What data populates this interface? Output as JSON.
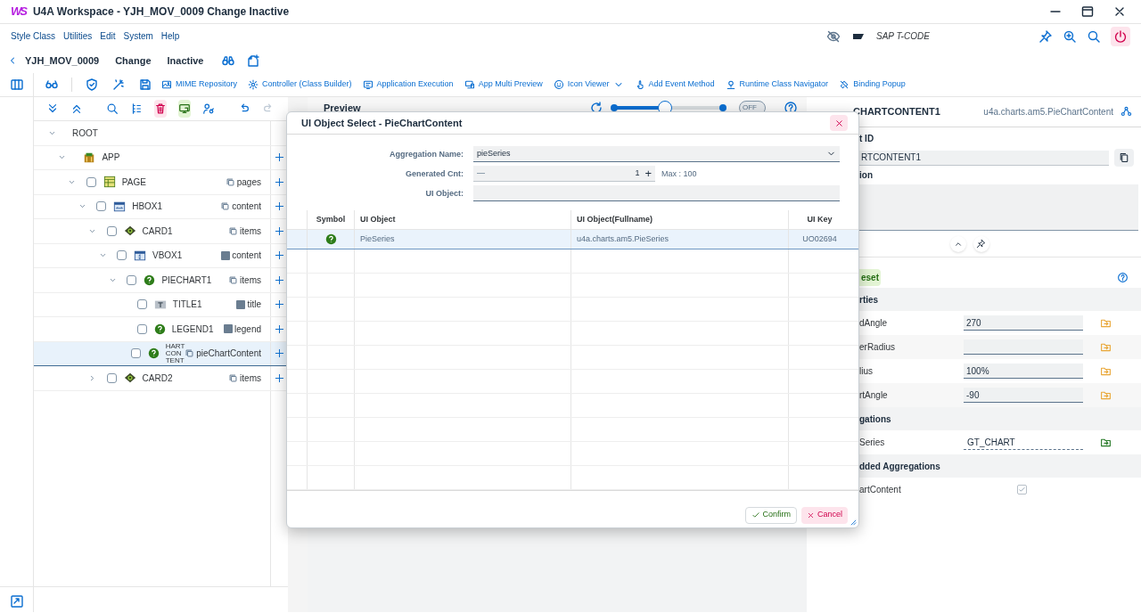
{
  "window": {
    "logo": "WS",
    "title": "U4A Workspace - YJH_MOV_0009 Change Inactive"
  },
  "menu": [
    "Style Class",
    "Utilities",
    "Edit",
    "System",
    "Help"
  ],
  "tcode": {
    "placeholder": "SAP T-CODE"
  },
  "header": {
    "program": "YJH_MOV_0009",
    "mode": "Change",
    "status": "Inactive"
  },
  "toolbar": [
    {
      "label": "MIME Repository"
    },
    {
      "label": "Controller (Class Builder)"
    },
    {
      "label": "Application Execution"
    },
    {
      "label": "App Multi Preview"
    },
    {
      "label": "Icon Viewer",
      "dropdown": true
    },
    {
      "label": "Add Event Method"
    },
    {
      "label": "Runtime Class Navigator"
    },
    {
      "label": "Binding Popup"
    }
  ],
  "tree": [
    {
      "label": "ROOT",
      "kind": "root",
      "expanded": true,
      "selected": false,
      "children": [
        {
          "label": "APP",
          "kind": "app",
          "expanded": true,
          "selected": false,
          "children": [
            {
              "label": "PAGE",
              "kind": "page",
              "checked": false,
              "expanded": true,
              "selected": false,
              "aggregation": {
                "label": "pages",
                "multiple": true
              },
              "children": [
                {
                  "label": "HBOX1",
                  "kind": "hbox",
                  "checked": false,
                  "expanded": true,
                  "selected": false,
                  "aggregation": {
                    "label": "content",
                    "multiple": true
                  },
                  "children": [
                    {
                      "label": "CARD1",
                      "kind": "card",
                      "checked": false,
                      "expanded": true,
                      "selected": false,
                      "aggregation": {
                        "label": "items",
                        "multiple": true
                      },
                      "children": [
                        {
                          "label": "VBOX1",
                          "kind": "vbox",
                          "checked": false,
                          "expanded": true,
                          "selected": false,
                          "aggregation": {
                            "label": "content",
                            "multiple": false
                          },
                          "children": [
                            {
                              "label": "PIECHART1",
                              "kind": "chart",
                              "checked": false,
                              "expanded": true,
                              "selected": false,
                              "aggregation": {
                                "label": "items",
                                "multiple": true
                              },
                              "children": [
                                {
                                  "label": "TITLE1",
                                  "kind": "title",
                                  "checked": false,
                                  "selected": false,
                                  "aggregation": {
                                    "label": "title",
                                    "multiple": false
                                  }
                                },
                                {
                                  "label": "LEGEND1",
                                  "kind": "chart",
                                  "checked": false,
                                  "selected": false,
                                  "aggregation": {
                                    "label": "legend",
                                    "multiple": false
                                  }
                                },
                                {
                                  "label": "HART CON TENT",
                                  "kind": "chart",
                                  "checked": false,
                                  "selected": true,
                                  "aggregation": {
                                    "label": "pieChartContent",
                                    "multiple": true
                                  }
                                }
                              ]
                            }
                          ]
                        }
                      ]
                    },
                    {
                      "label": "CARD2",
                      "kind": "card",
                      "checked": false,
                      "expanded": false,
                      "selected": false,
                      "aggregation": {
                        "label": "items",
                        "multiple": true
                      }
                    }
                  ]
                }
              ]
            }
          ]
        }
      ]
    }
  ],
  "preview": {
    "title": "Preview",
    "zoom": {
      "level": 0.47
    },
    "toggle": {
      "label": "OFF",
      "on": false
    }
  },
  "dialog": {
    "title": "UI Object Select - PieChartContent",
    "fields": [
      {
        "label": "Aggregation Name:",
        "kind": "select",
        "value": "pieSeries"
      },
      {
        "label": "Generated Cnt:",
        "kind": "stepper",
        "minus": "—",
        "value": "1",
        "plus": "+",
        "max": "Max : 100"
      },
      {
        "label": "UI Object:",
        "kind": "text"
      }
    ],
    "columns": [
      "Symbol",
      "UI Object",
      "UI Object(Fullname)",
      "UI Key"
    ],
    "rows": [
      {
        "cells": [
          "",
          "PieSeries",
          "u4a.charts.am5.PieSeries",
          "UO02694"
        ],
        "selected": true
      }
    ],
    "buttons": [
      {
        "label": "Confirm",
        "kind": "confirm"
      },
      {
        "label": "Cancel",
        "kind": "cancel"
      }
    ]
  },
  "properties_panel": {
    "title": "CHARTCONTENT1",
    "class_name": "u4a.charts.am5.PieChartContent",
    "id_label": "t ID",
    "id_value": "RTCONTENT1",
    "description_label": "ion",
    "reset": "eset",
    "sections": [
      {
        "title": "rties",
        "rows": [
          {
            "label": "dAngle",
            "kind": "property",
            "value": "270"
          },
          {
            "label": "erRadius",
            "kind": "property"
          },
          {
            "label": "lius",
            "kind": "property",
            "value": "100%"
          },
          {
            "label": "rtAngle",
            "kind": "property",
            "value": "-90"
          }
        ]
      },
      {
        "title": "gations",
        "rows": [
          {
            "label": "Series",
            "kind": "binding",
            "value": "GT_CHART"
          }
        ]
      },
      {
        "title": "dded Aggregations",
        "rows": [
          {
            "label": "artContent",
            "kind": "checkbox",
            "checked": true
          }
        ]
      }
    ]
  }
}
